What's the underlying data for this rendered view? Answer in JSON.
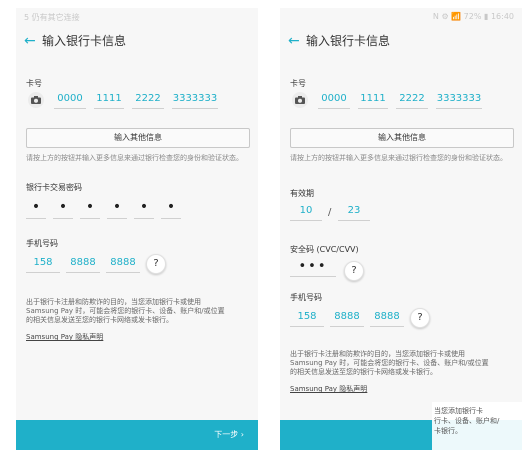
{
  "left": {
    "status": {
      "left": "5 仍有其它连接",
      "right": ""
    },
    "title": "输入银行卡信息",
    "card_label": "卡号",
    "card_segments": [
      "0000",
      "1111",
      "2222",
      "3333333"
    ],
    "more_button": "输入其他信息",
    "more_hint": "请按上方的按钮并输入更多信息来通过银行检查您的身份和验证状态。",
    "pin_label": "银行卡交易密码",
    "pin_dots": [
      "•",
      "•",
      "•",
      "•",
      "•",
      "•"
    ],
    "phone_label": "手机号码",
    "phone_segments": [
      "158",
      "8888",
      "8888"
    ],
    "help_glyph": "?",
    "privacy_text_1": "出于银行卡注册和防欺诈的目的，当您添加银行卡或使用",
    "privacy_text_2": "Samsung Pay 时，可能会将您的银行卡、设备、账户和/或位置",
    "privacy_text_3": "的相关信息发送至您的银行卡网络或发卡银行。",
    "privacy_link": "Samsung Pay 隐私声明",
    "next_button": "下一步 ›"
  },
  "right": {
    "status": {
      "left": "",
      "right": "N ⚙ 📶 72% ▮ 16:40"
    },
    "title": "输入银行卡信息",
    "card_label": "卡号",
    "card_segments": [
      "0000",
      "1111",
      "2222",
      "3333333"
    ],
    "more_button": "输入其他信息",
    "more_hint": "请按上方的按钮并输入更多信息来通过银行检查您的身份和验证状态。",
    "expiry_label": "有效期",
    "expiry_month": "10",
    "expiry_sep": "/",
    "expiry_year": "23",
    "cvc_label": "安全码 (CVC/CVV)",
    "cvc_dots": "•••",
    "phone_label": "手机号码",
    "phone_segments": [
      "158",
      "8888",
      "8888"
    ],
    "help_glyph": "?",
    "privacy_text_1": "出于银行卡注册和防欺诈的目的，当您添加银行卡或使用",
    "privacy_text_2": "Samsung Pay 时，可能会将您的银行卡、设备、账户和/或位置",
    "privacy_text_3": "的相关信息发送至您的银行卡网络或发卡银行。",
    "privacy_link": "Samsung Pay 隐私声明",
    "overlay_1": "当您添加银行卡",
    "overlay_2": "行卡、设备、账户和/",
    "overlay_3": "卡银行。"
  },
  "accent_color": "#1fb0c9"
}
